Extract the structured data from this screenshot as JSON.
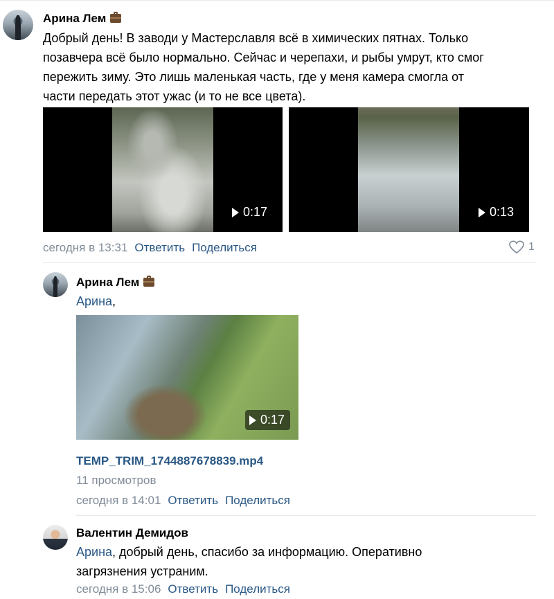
{
  "post": {
    "author": "Арина Лем",
    "author_badge_icon": "briefcase-icon",
    "text_lines": [
      "Добрый день! В заводи у Мастерславля всё в химических пятнах. Только",
      "позавчера всё было нормально. Сейчас и черепахи, и рыбы умрут, кто смог",
      "пережить зиму. Это лишь маленькая часть, где у меня камера смогла от",
      "части передать этот ужас (и то не все цвета)."
    ],
    "videos": [
      {
        "duration": "0:17",
        "icon": "play-icon"
      },
      {
        "duration": "0:13",
        "icon": "play-icon"
      }
    ],
    "time": "сегодня в 13:31",
    "reply_label": "Ответить",
    "share_label": "Поделиться",
    "likes": "1",
    "like_icon": "heart-icon"
  },
  "comments": [
    {
      "author": "Арина Лем",
      "author_badge_icon": "briefcase-icon",
      "mention": "Арина",
      "text": ",",
      "video": {
        "duration": "0:17",
        "icon": "play-icon"
      },
      "file_name": "TEMP_TRIM_1744887678839.mp4",
      "views": "11 просмотров",
      "time": "сегодня в 14:01",
      "reply_label": "Ответить",
      "share_label": "Поделиться"
    },
    {
      "author": "Валентин Демидов",
      "mention": "Арина",
      "text_line1": ", добрый день, спасибо за информацию. Оперативно",
      "text_line2": "загрязнения устраним.",
      "time": "сегодня в 15:06",
      "reply_label": "Ответить",
      "share_label": "Поделиться"
    }
  ],
  "colors": {
    "link": "#2a5885",
    "meta": "#818c99",
    "divider": "#e7e8ec"
  }
}
